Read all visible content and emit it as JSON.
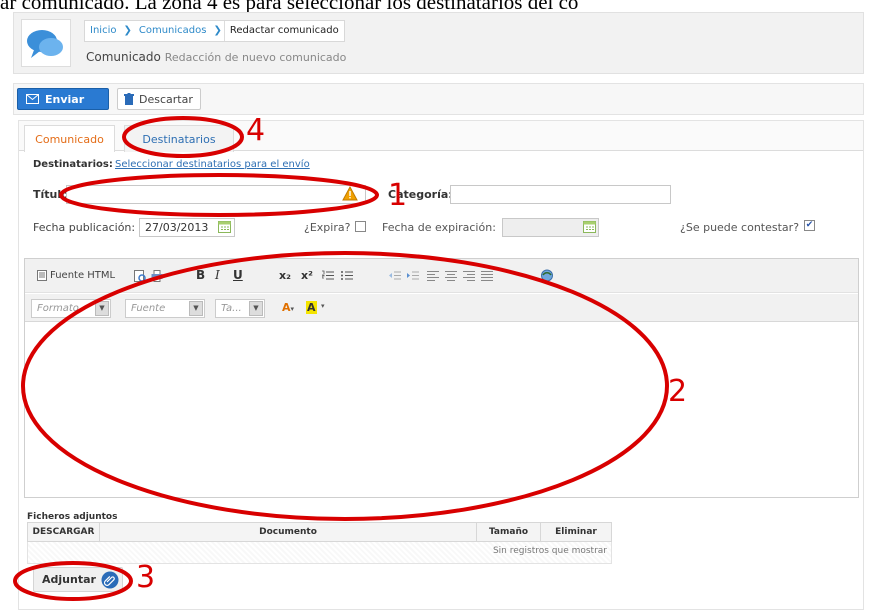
{
  "caption": "ar comunicado. La zona 4 es para seleccionar los destinatarios del co",
  "breadcrumb": {
    "items": [
      "Inicio",
      "Comunicados",
      "Redactar comunicado"
    ],
    "separator": "❯"
  },
  "header": {
    "title": "Comunicado",
    "subtitle": "Redacción de nuevo comunicado"
  },
  "toolbar": {
    "send_label": "Enviar",
    "discard_label": "Descartar"
  },
  "tabs": [
    {
      "label": "Comunicado",
      "active": true
    },
    {
      "label": "Destinatarios",
      "active": false
    }
  ],
  "form": {
    "recipients_label": "Destinatarios:",
    "recipients_link": "Seleccionar destinatarios para el envío",
    "title_label": "Título",
    "title_value": "",
    "category_label": "Categoría:",
    "category_value": "",
    "pub_date_label": "Fecha publicación:",
    "pub_date_value": "27/03/2013",
    "expires_label": "¿Expira?",
    "expires_checked": false,
    "exp_date_label": "Fecha de expiración:",
    "exp_date_value": "",
    "reply_label": "¿Se puede contestar?",
    "reply_checked": true
  },
  "editor": {
    "source_label": "Fuente HTML",
    "format_placeholder": "Formato",
    "font_placeholder": "Fuente",
    "size_placeholder": "Ta...",
    "toolbar_icons": [
      "preview-icon",
      "print-icon",
      "bold-icon",
      "italic-icon",
      "underline-icon",
      "subscript-icon",
      "superscript-icon",
      "ordered-list-icon",
      "bullet-list-icon",
      "outdent-icon",
      "indent-icon",
      "align-left-icon",
      "align-center-icon",
      "align-right-icon",
      "justify-icon",
      "image-icon"
    ],
    "subscript": "x₂",
    "superscript": "x²"
  },
  "attachments": {
    "title": "Ficheros adjuntos",
    "columns": [
      "DESCARGAR",
      "Documento",
      "Tamaño",
      "Eliminar"
    ],
    "empty_message": "Sin registros que mostrar",
    "attach_label": "Adjuntar"
  },
  "annotations": {
    "zone1": "1",
    "zone2": "2",
    "zone3": "3",
    "zone4": "4",
    "color": "#d80000"
  },
  "colors": {
    "accent": "#2a7ad2",
    "active_tab": "#e46d18",
    "link": "#2e6fb3",
    "warning": "#f0a000"
  }
}
